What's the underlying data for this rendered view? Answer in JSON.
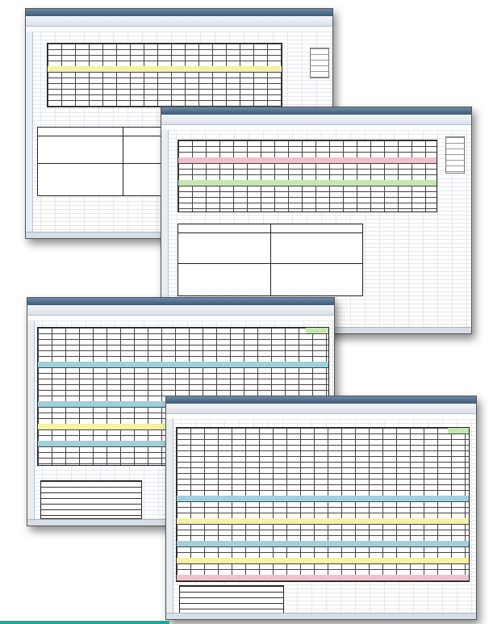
{
  "app": {
    "accent_color": "#1aa9a0",
    "window_chrome_color": "#3d5a78"
  },
  "screenshots": [
    {
      "name": "planning-form-back",
      "kind": "spreadsheet-form"
    },
    {
      "name": "planning-form-front",
      "kind": "spreadsheet-form"
    },
    {
      "name": "monthly-grid-back",
      "kind": "spreadsheet-grid"
    },
    {
      "name": "monthly-grid-front",
      "kind": "spreadsheet-grid"
    }
  ]
}
